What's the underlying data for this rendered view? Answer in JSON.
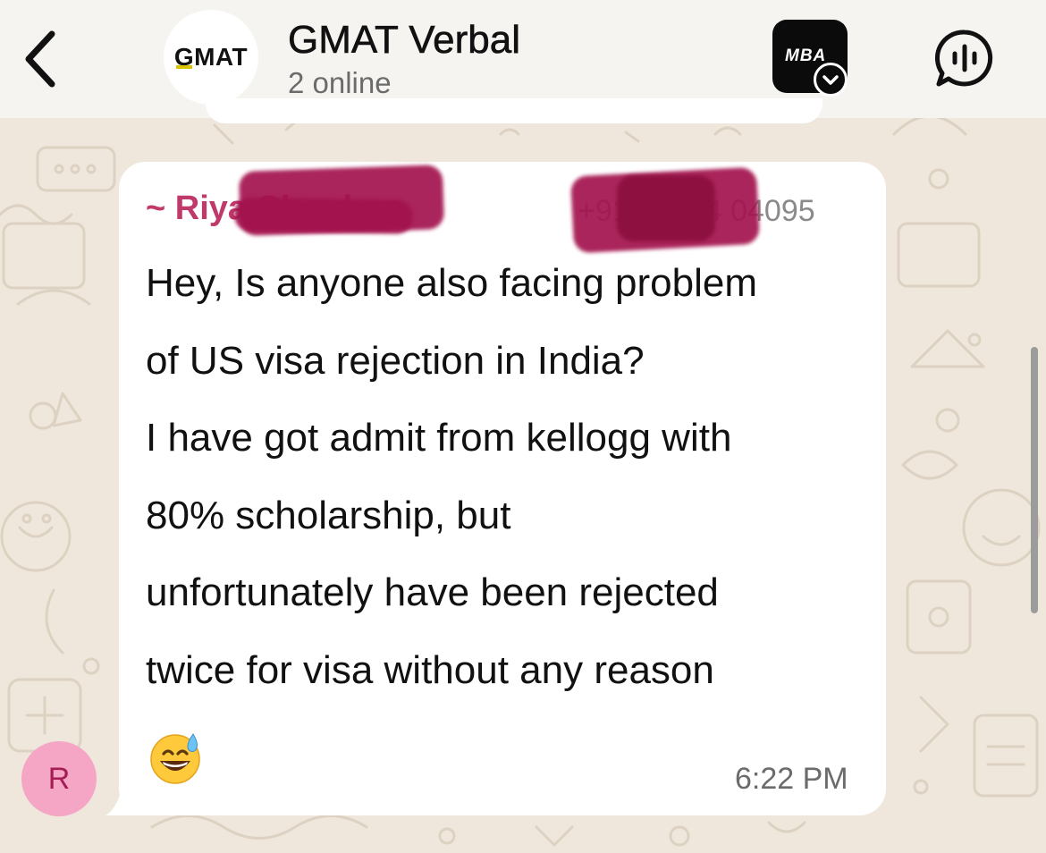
{
  "header": {
    "back_icon": "chevron-left-icon",
    "group_logo_text": "GMAT",
    "title": "GMAT Verbal",
    "subtitle": "2 online",
    "mba_badge_text": "MBA",
    "voice_icon": "voice-chat-icon"
  },
  "message": {
    "sender_name": "~ Riya Chouhan",
    "sender_phone": "+91 88714 04095",
    "lines": [
      "Hey, Is anyone also facing problem",
      "of US visa rejection in India?",
      "I have got admit from kellogg with",
      "80% scholarship, but",
      "unfortunately have been rejected",
      "twice for visa without any reason"
    ],
    "emoji": "😅",
    "time": "6:22 PM",
    "avatar_initial": "R"
  },
  "colors": {
    "wallpaper": "#efe7dc",
    "sender_name": "#c0396b",
    "redaction": "#a3134e",
    "avatar_bg": "#f4a6c4"
  }
}
